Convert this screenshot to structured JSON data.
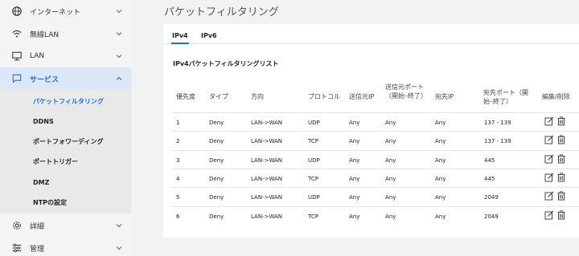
{
  "sidebar": {
    "items": [
      {
        "label": "インターネット",
        "icon": "globe-icon"
      },
      {
        "label": "無線LAN",
        "icon": "wifi-icon"
      },
      {
        "label": "LAN",
        "icon": "monitor-icon"
      },
      {
        "label": "サービス",
        "icon": "chat-icon"
      },
      {
        "label": "詳細",
        "icon": "gear-icon"
      },
      {
        "label": "管理",
        "icon": "sliders-icon"
      }
    ],
    "sub_items": [
      {
        "label": "パケットフィルタリング"
      },
      {
        "label": "DDNS"
      },
      {
        "label": "ポートフォワーディング"
      },
      {
        "label": "ポートトリガー"
      },
      {
        "label": "DMZ"
      },
      {
        "label": "NTPの設定"
      }
    ]
  },
  "main": {
    "title": "パケットフィルタリング",
    "tabs": [
      {
        "label": "IPv4"
      },
      {
        "label": "IPv6"
      }
    ],
    "list_title": "IPv4パケットフィルタリングリスト",
    "columns": [
      "優先度",
      "タイプ",
      "方向",
      "プロトコル",
      "送信元IP",
      "送信元ポート（開始–終了）",
      "宛先IP",
      "宛先ポート（開始–終了）",
      "編集/削除"
    ],
    "rows": [
      [
        "1",
        "Deny",
        "LAN->WAN",
        "UDP",
        "Any",
        "Any",
        "Any",
        "137 - 139"
      ],
      [
        "2",
        "Deny",
        "LAN->WAN",
        "TCP",
        "Any",
        "Any",
        "Any",
        "137 - 139"
      ],
      [
        "3",
        "Deny",
        "LAN->WAN",
        "UDP",
        "Any",
        "Any",
        "Any",
        "445"
      ],
      [
        "4",
        "Deny",
        "LAN->WAN",
        "TCP",
        "Any",
        "Any",
        "Any",
        "445"
      ],
      [
        "5",
        "Deny",
        "LAN->WAN",
        "UDP",
        "Any",
        "Any",
        "Any",
        "2049"
      ],
      [
        "6",
        "Deny",
        "LAN->WAN",
        "TCP",
        "Any",
        "Any",
        "Any",
        "2049"
      ]
    ]
  },
  "colors": {
    "accent": "#1f6fd0",
    "active_bg": "#dce8f7"
  }
}
